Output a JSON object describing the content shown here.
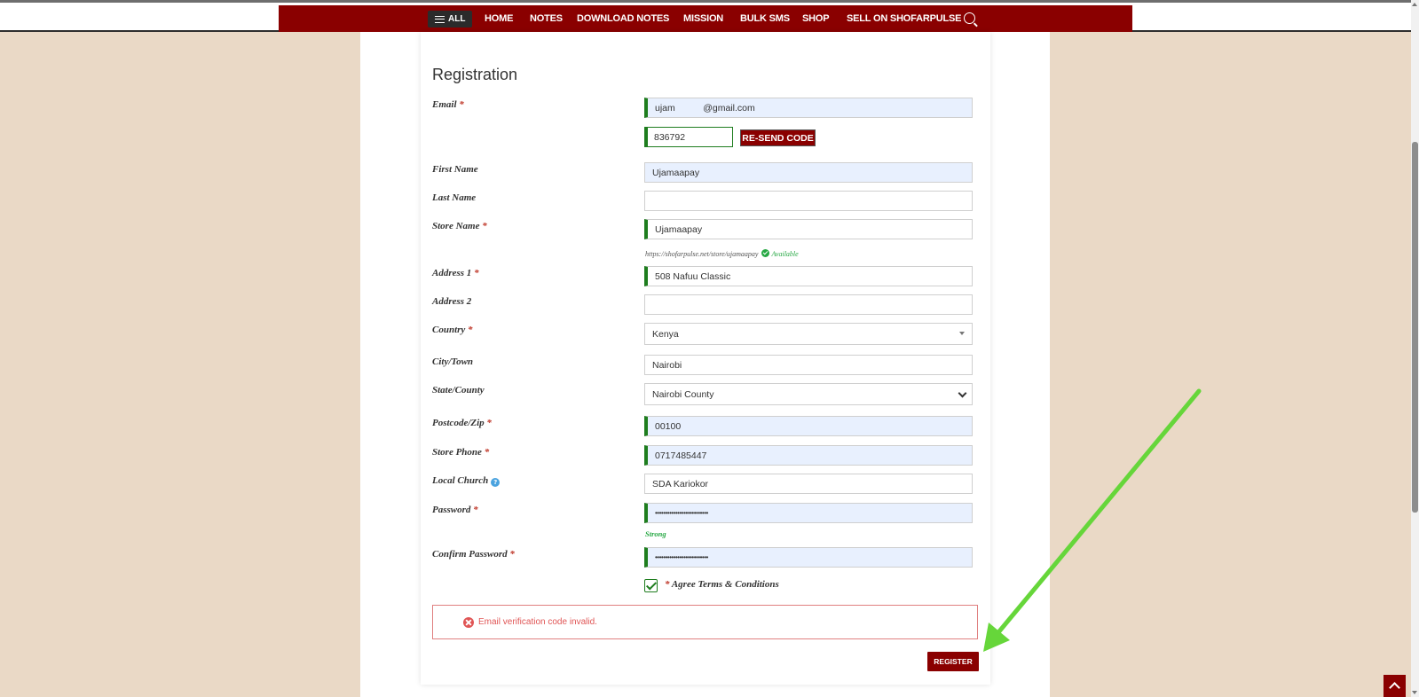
{
  "nav": {
    "all_label": "ALL",
    "links": [
      "HOME",
      "NOTES",
      "DOWNLOAD NOTES",
      "MISSION",
      "BULK SMS",
      "SHOP",
      "SELL ON SHOFARPULSE"
    ]
  },
  "form": {
    "title": "Registration",
    "email": {
      "label": "Email",
      "value": "ujam   @gmail.com"
    },
    "code": {
      "value": "836792",
      "resend_label": "RE-SEND CODE"
    },
    "first_name": {
      "label": "First Name",
      "value": "Ujamaapay"
    },
    "last_name": {
      "label": "Last Name",
      "value": ""
    },
    "store_name": {
      "label": "Store Name",
      "value": "Ujamaapay",
      "url_hint": "https://shofarpulse.net/store/ujamaapay",
      "available": "Available"
    },
    "address1": {
      "label": "Address 1",
      "value": "508 Nafuu Classic"
    },
    "address2": {
      "label": "Address 2",
      "value": ""
    },
    "country": {
      "label": "Country",
      "value": "Kenya"
    },
    "city": {
      "label": "City/Town",
      "value": "Nairobi"
    },
    "state": {
      "label": "State/County",
      "value": "Nairobi County"
    },
    "postcode": {
      "label": "Postcode/Zip",
      "value": "00100"
    },
    "phone": {
      "label": "Store Phone",
      "value": "0717485447"
    },
    "church": {
      "label": "Local Church",
      "value": "SDA Kariokor"
    },
    "password": {
      "label": "Password",
      "value": "••••••••••••••••••••••••••",
      "strength": "Strong"
    },
    "confirm_password": {
      "label": "Confirm Password",
      "value": "••••••••••••••••••••••••••"
    },
    "terms_label": "Agree  Terms & Conditions",
    "terms_checked": true,
    "required_mark": "*",
    "help_glyph": "?",
    "error": "Email verification code invalid.",
    "register_label": "REGISTER"
  },
  "colors": {
    "brand": "#8a0000",
    "side_bg": "#ead9c6",
    "annotation_arrow": "#66d63a",
    "success": "#27a844",
    "error": "#e05555"
  }
}
